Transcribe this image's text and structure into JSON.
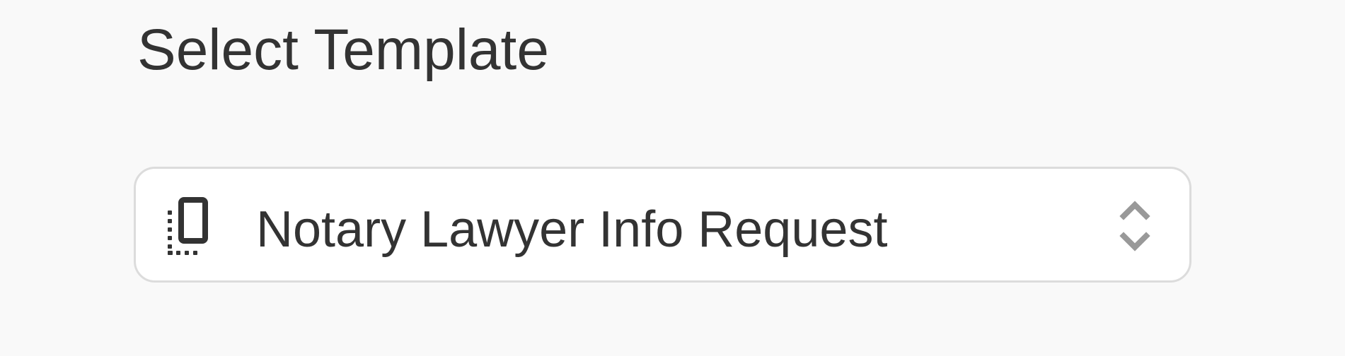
{
  "page": {
    "title": "Select Template"
  },
  "template_select": {
    "selected_value": "Notary Lawyer Info Request",
    "icon": "template-document-icon",
    "toggle_icon": "chevron-up-down-icon"
  },
  "colors": {
    "background": "#f9f9f9",
    "text": "#333333",
    "border": "#dcdcdc",
    "chevron": "#999999"
  }
}
